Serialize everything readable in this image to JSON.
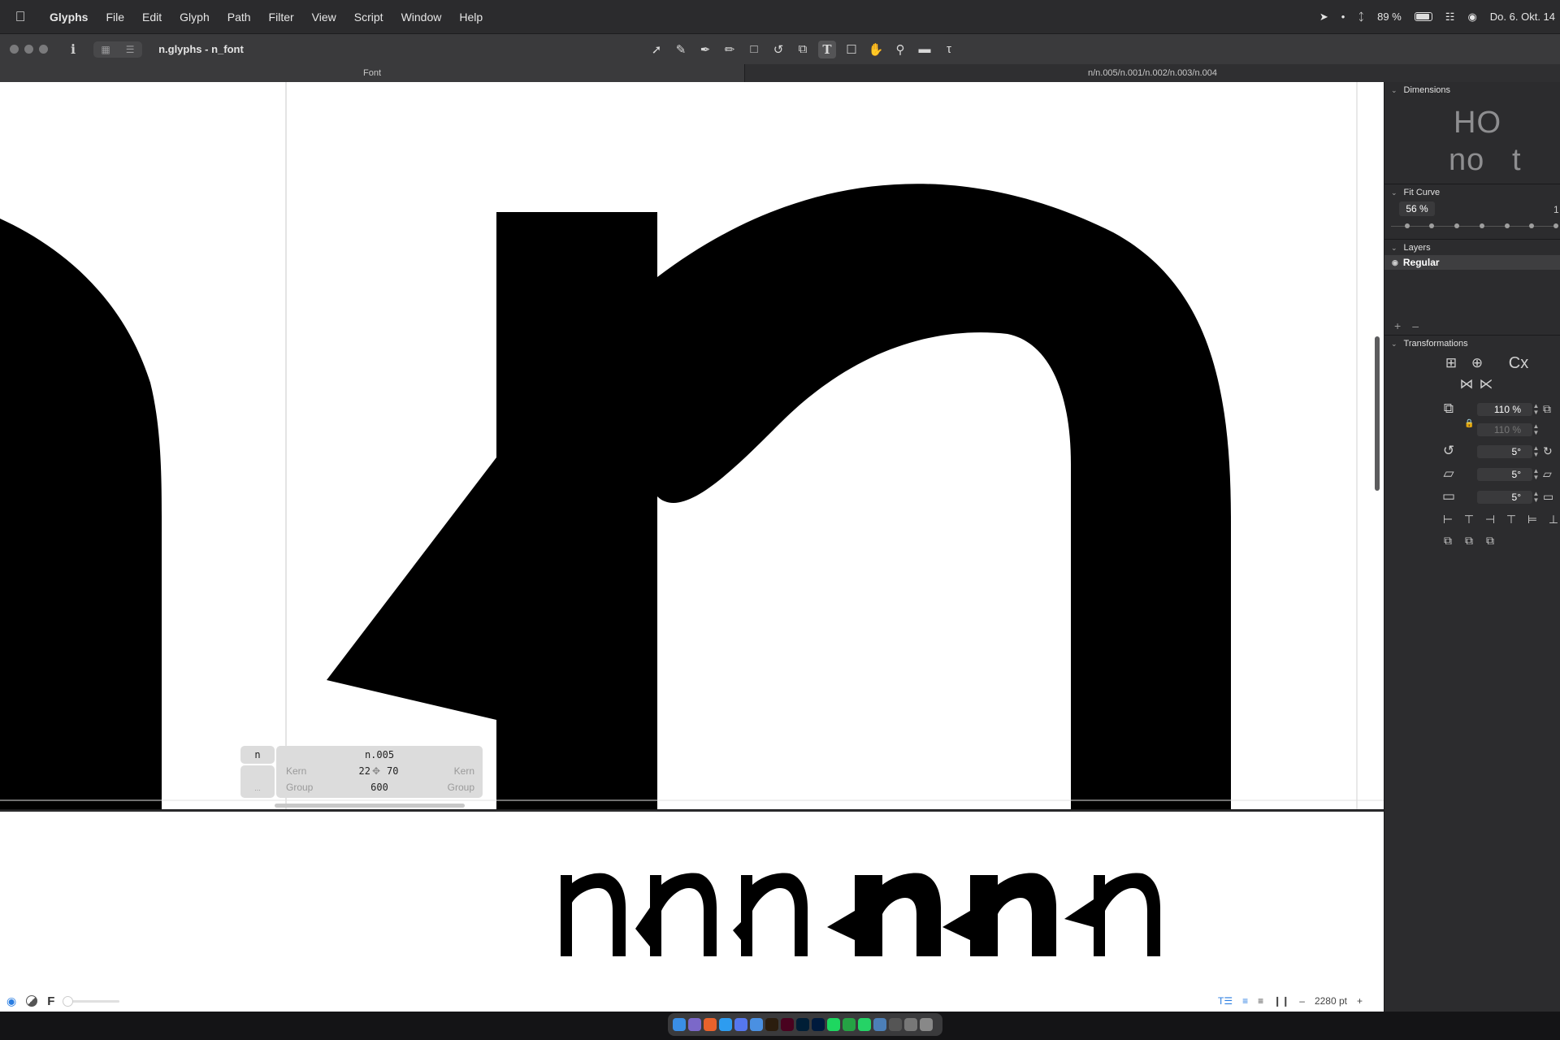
{
  "menubar": {
    "app_name": "Glyphs",
    "menus": [
      "File",
      "Edit",
      "Glyph",
      "Path",
      "Filter",
      "View",
      "Script",
      "Window",
      "Help"
    ],
    "battery": "89 %",
    "datetime": "Do. 6. Okt. 14"
  },
  "window": {
    "title": "n.glyphs - n_font",
    "tabs": [
      "Font",
      "n/n.005/n.001/n.002/n.003/n.004"
    ]
  },
  "tools": [
    "select-arrow-icon",
    "draw-icon",
    "pen-icon",
    "pencil-icon",
    "rectangle-icon",
    "rotate-icon",
    "scale-icon",
    "text-tool-icon",
    "annotation-icon",
    "hand-icon",
    "zoom-icon",
    "measure-icon",
    "type-icon"
  ],
  "glyph_info": {
    "left_glyph": "n",
    "name": "n.005",
    "kern_label": "Kern",
    "group_label": "Group",
    "lsb": "22",
    "rsb": "70",
    "width": "600",
    "more": "..."
  },
  "preview": {
    "glyphs": [
      "n",
      "n.005",
      "n.001",
      "n.002",
      "n.003",
      "n.004"
    ]
  },
  "bottombar": {
    "size": "2280 pt",
    "minus": "–",
    "plus": "+"
  },
  "sidebar": {
    "dimensions": {
      "title": "Dimensions",
      "sample1": "HO",
      "sample2": "no",
      "sample3": "t"
    },
    "fit_curve": {
      "title": "Fit Curve",
      "value": "56 %",
      "more": "1"
    },
    "layers": {
      "title": "Layers",
      "items": [
        "Regular"
      ],
      "add": "+",
      "remove": "–"
    },
    "transformations": {
      "title": "Transformations",
      "scale_x": "110 %",
      "scale_y": "110 %",
      "rotate": "5°",
      "slant": "5°",
      "skew": "5°",
      "cx": "Cx"
    }
  },
  "colors": {
    "accent": "#2a7de1",
    "chrome": "#2b2b2d",
    "sidebar": "#2c2c2e",
    "ink": "#000000"
  }
}
